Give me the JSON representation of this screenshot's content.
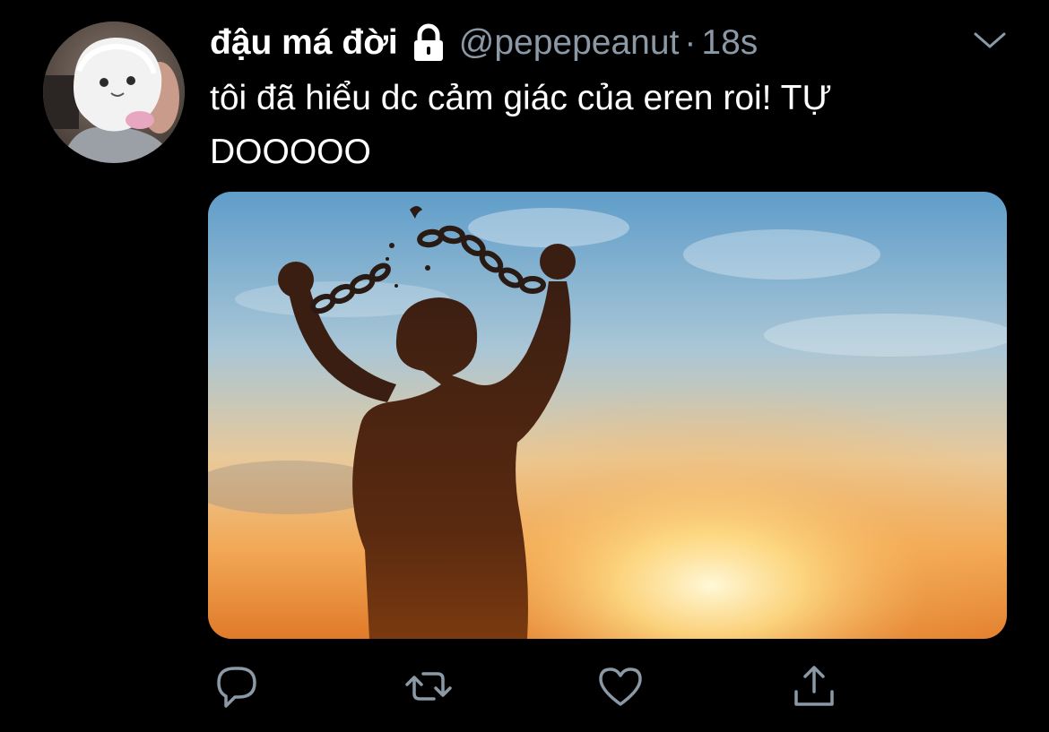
{
  "tweet": {
    "display_name": "đậu má đời",
    "handle": "@pepepeanut",
    "separator": "·",
    "time": "18s",
    "text": "tôi đã hiểu dc cảm giác của eren roi! TỰ\nDOOOOO",
    "protected": true
  },
  "icons": {
    "lock": "lock-icon",
    "chevron": "chevron-down-icon",
    "reply": "reply-icon",
    "retweet": "retweet-icon",
    "like": "like-icon",
    "share": "share-icon"
  },
  "colors": {
    "background": "#000000",
    "primary_text": "#ffffff",
    "secondary_text": "#8b98a5",
    "icon": "#8b98a5"
  }
}
